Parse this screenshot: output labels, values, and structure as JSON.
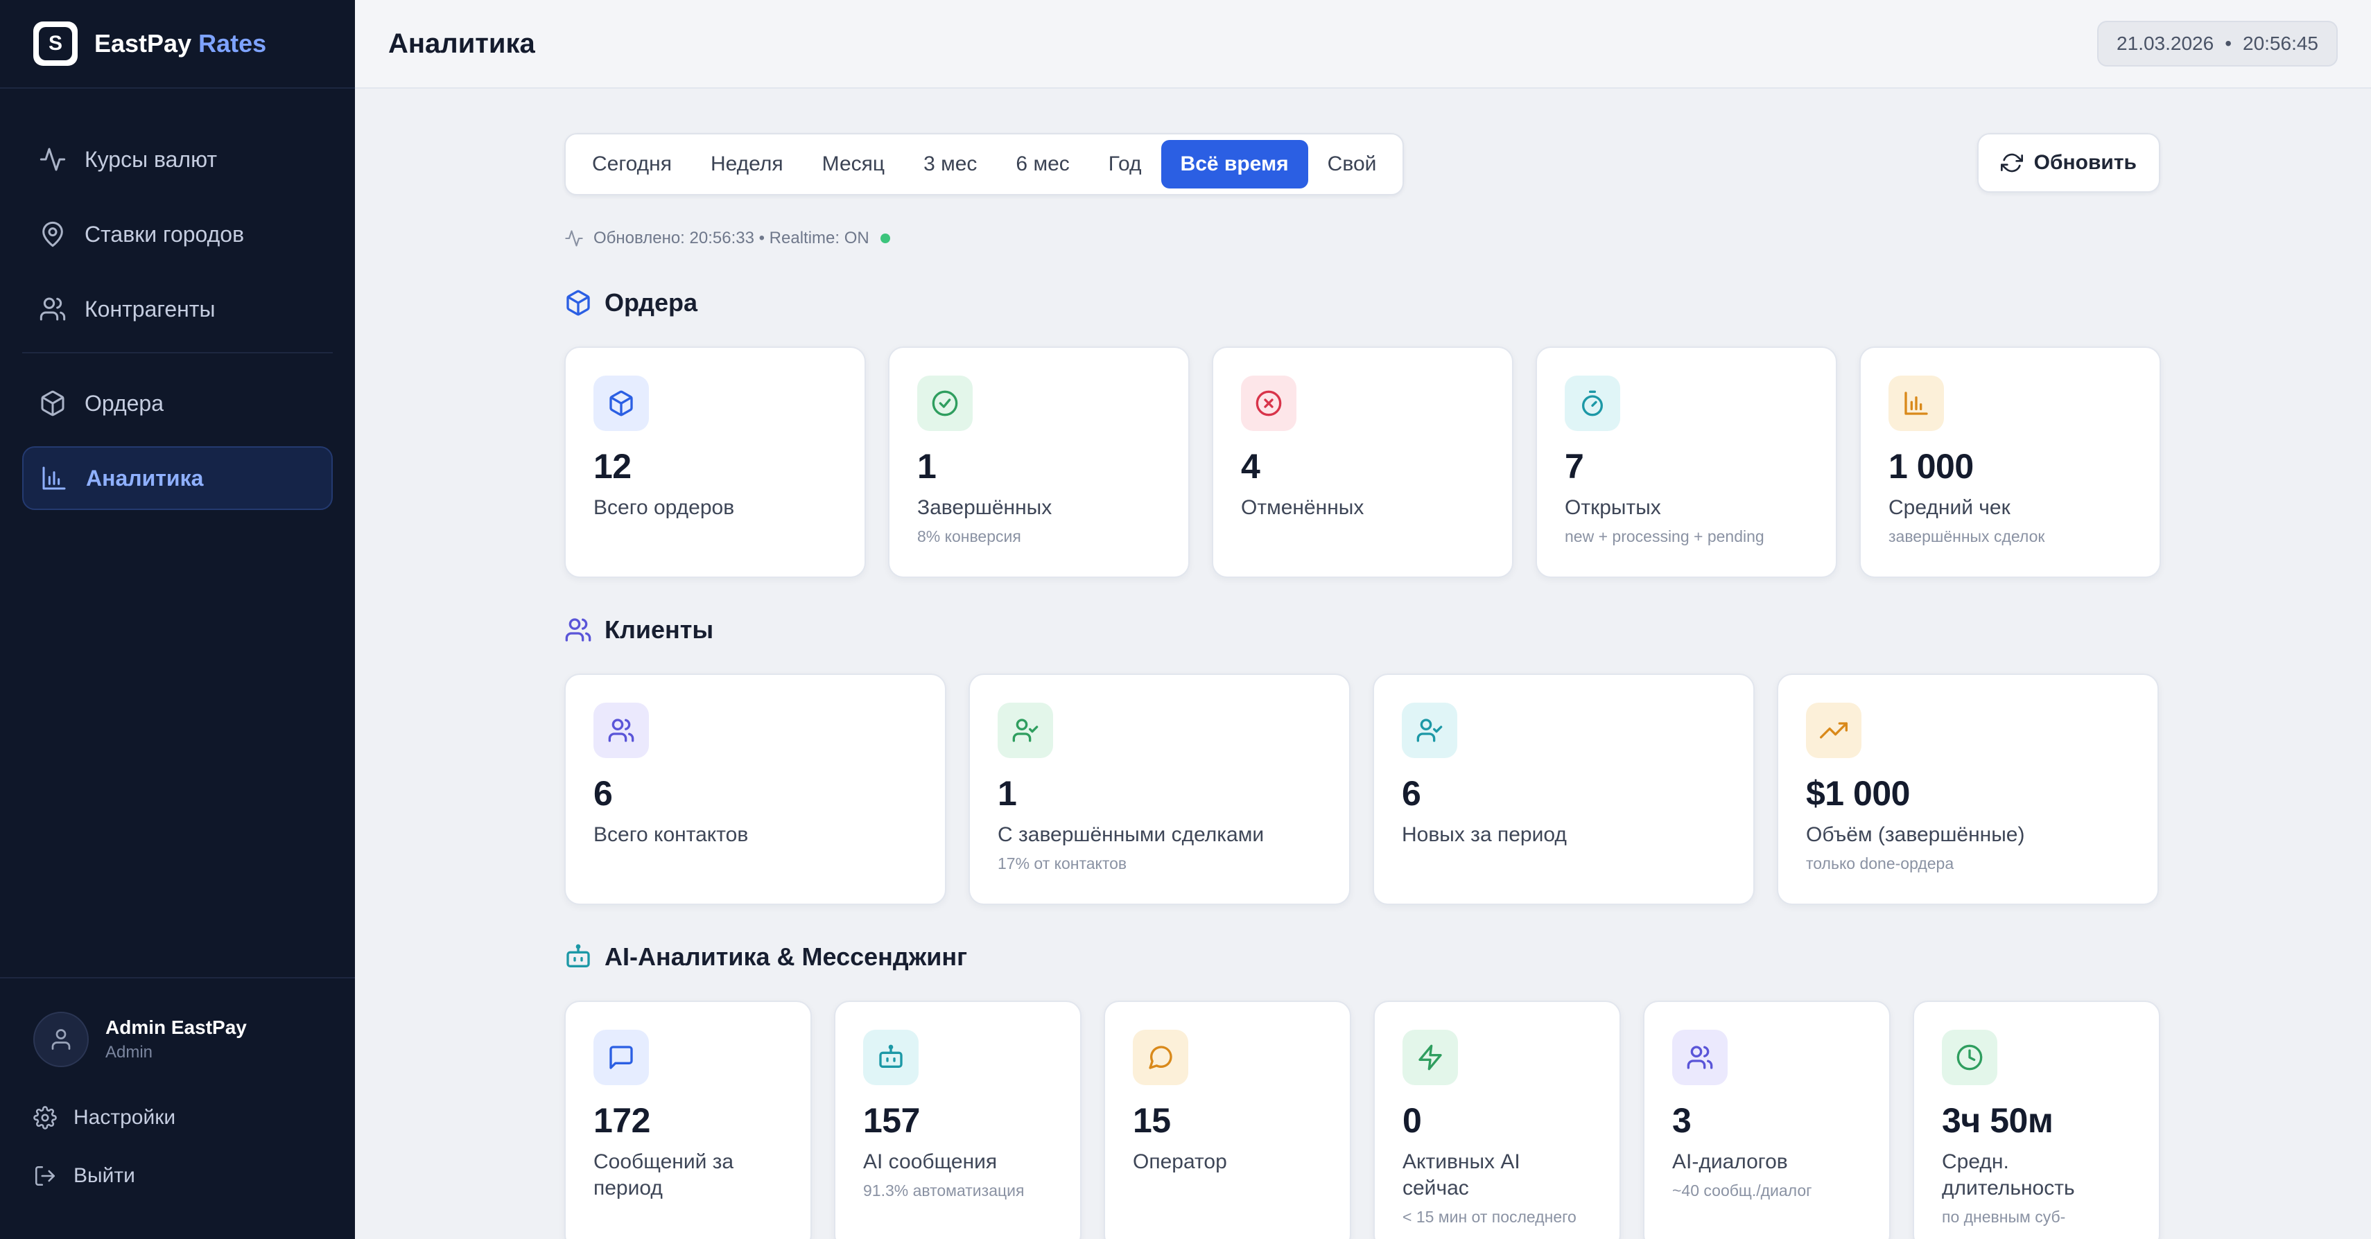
{
  "brand": {
    "name": "EastPay",
    "accent": "Rates",
    "logo_glyph": "S"
  },
  "sidebar": {
    "items": [
      {
        "label": "Курсы валют",
        "icon": "activity-icon"
      },
      {
        "label": "Ставки городов",
        "icon": "map-pin-icon"
      },
      {
        "label": "Контрагенты",
        "icon": "users-icon"
      },
      {
        "label": "Ордера",
        "icon": "box-icon"
      },
      {
        "label": "Аналитика",
        "icon": "bar-chart-icon",
        "active": true
      }
    ],
    "user": {
      "name": "Admin EastPay",
      "role": "Admin"
    },
    "settings_label": "Настройки",
    "logout_label": "Выйти"
  },
  "header": {
    "title": "Аналитика",
    "date": "21.03.2026",
    "separator": "•",
    "time": "20:56:45"
  },
  "filters": {
    "options": [
      "Сегодня",
      "Неделя",
      "Месяц",
      "3 мес",
      "6 мес",
      "Год",
      "Всё время",
      "Свой"
    ],
    "active": "Всё время",
    "refresh_label": "Обновить"
  },
  "status": {
    "text": "Обновлено: 20:56:33 • Realtime: ON"
  },
  "orders": {
    "title": "Ордера",
    "cards": [
      {
        "value": "12",
        "label": "Всего ордеров",
        "sub": ""
      },
      {
        "value": "1",
        "label": "Завершённых",
        "sub": "8% конверсия"
      },
      {
        "value": "4",
        "label": "Отменённых",
        "sub": ""
      },
      {
        "value": "7",
        "label": "Открытых",
        "sub": "new + processing + pending"
      },
      {
        "value": "1 000",
        "label": "Средний чек",
        "sub": "завершённых сделок"
      }
    ]
  },
  "clients": {
    "title": "Клиенты",
    "cards": [
      {
        "value": "6",
        "label": "Всего контактов",
        "sub": ""
      },
      {
        "value": "1",
        "label": "С завершёнными сделками",
        "sub": "17% от контактов"
      },
      {
        "value": "6",
        "label": "Новых за период",
        "sub": ""
      },
      {
        "value": "$1 000",
        "label": "Объём (завершённые)",
        "sub": "только done-ордера"
      }
    ]
  },
  "ai": {
    "title": "AI-Аналитика & Мессенджинг",
    "cards": [
      {
        "value": "172",
        "label": "Сообщений за период",
        "sub": ""
      },
      {
        "value": "157",
        "label": "AI сообщения",
        "sub": "91.3% автоматизация"
      },
      {
        "value": "15",
        "label": "Оператор",
        "sub": ""
      },
      {
        "value": "0",
        "label": "Активных AI сейчас",
        "sub": "< 15 мин от последнего"
      },
      {
        "value": "3",
        "label": "AI-диалогов",
        "sub": "~40 сообщ./диалог"
      },
      {
        "value": "3ч 50м",
        "label": "Средн. длительность",
        "sub": "по дневным суб-"
      }
    ]
  },
  "colors": {
    "sidebar_bg": "#0f1729",
    "accent": "#2b5fe3",
    "success": "#2f9e5f",
    "danger": "#d8344a",
    "teal": "#1c98a6",
    "amber": "#d9891a",
    "violet": "#5a55d8"
  }
}
